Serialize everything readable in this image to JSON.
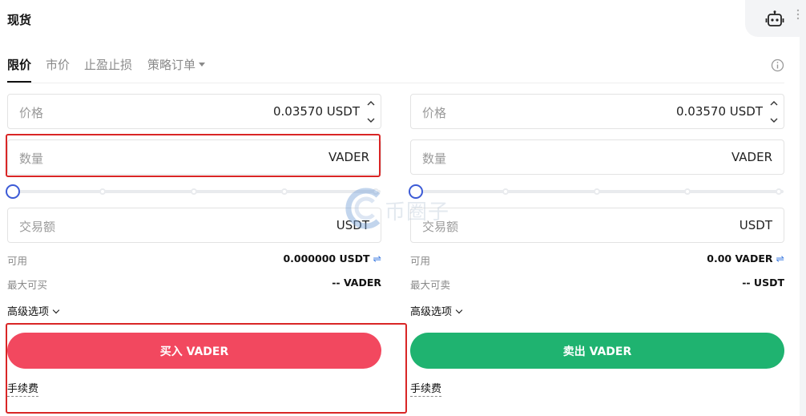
{
  "header": {
    "title": "现货"
  },
  "tabs": [
    {
      "label": "限价",
      "active": true
    },
    {
      "label": "市价",
      "active": false
    },
    {
      "label": "止盈止损",
      "active": false
    },
    {
      "label": "策略订单",
      "active": false
    }
  ],
  "buy": {
    "price": {
      "label": "价格",
      "value": "0.03570 USDT"
    },
    "amount": {
      "label": "数量",
      "unit": "VADER"
    },
    "total": {
      "label": "交易额",
      "unit": "USDT"
    },
    "slider_value": 0,
    "available": {
      "label": "可用",
      "value": "0.000000 USDT"
    },
    "max": {
      "label": "最大可买",
      "value": "-- VADER"
    },
    "advanced": "高级选项",
    "button": "买入 VADER",
    "fee": "手续费"
  },
  "sell": {
    "price": {
      "label": "价格",
      "value": "0.03570 USDT"
    },
    "amount": {
      "label": "数量",
      "unit": "VADER"
    },
    "total": {
      "label": "交易额",
      "unit": "USDT"
    },
    "slider_value": 0,
    "available": {
      "label": "可用",
      "value": "0.00 VADER"
    },
    "max": {
      "label": "最大可卖",
      "value": "-- USDT"
    },
    "advanced": "高级选项",
    "button": "卖出 VADER",
    "fee": "手续费"
  },
  "swap_symbol": "⇌",
  "watermark": "币圈子",
  "colors": {
    "buy": "#f2485f",
    "sell": "#1fb370",
    "accent": "#3c5bd6",
    "highlight": "#d92626"
  },
  "icons": [
    "robot-icon",
    "more-icon",
    "info-icon",
    "chevron-down-icon",
    "caret-down-icon",
    "step-up-icon",
    "step-down-icon",
    "swap-icon"
  ]
}
